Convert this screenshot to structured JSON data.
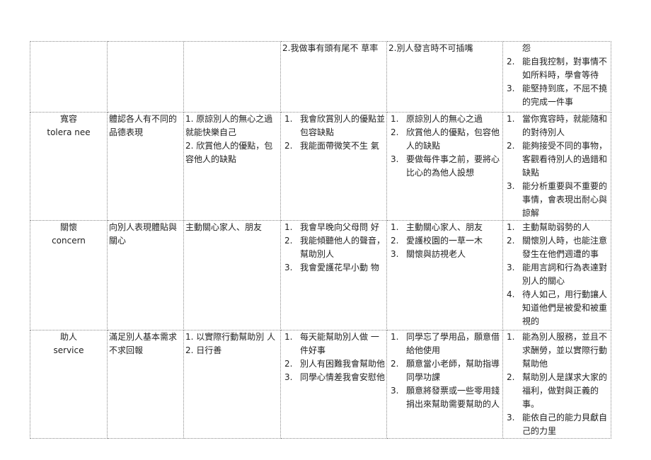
{
  "top_row": {
    "col4": "2.我做事有頭有尾不 草率",
    "col5": "2.別人發言時不可插嘴",
    "col6_continuation": "怨",
    "col6_items": [
      {
        "num": "2.",
        "text": "能自我控制，對事情不如所料時，學會等待"
      },
      {
        "num": "3.",
        "text": "能堅持到底，不屈不撓的完成一件事"
      }
    ]
  },
  "rows": [
    {
      "virtue_zh": "寬容",
      "virtue_en": "tolera nee",
      "definition": "體認各人有不同的品德表現",
      "goals": [
        "1. 原諒別人的無心之過就能快樂自己",
        "2. 欣賞他人的優點，包容他人的缺點"
      ],
      "col4_items": [
        {
          "num": "1.",
          "text": "我會欣賞別人的優點並包容缺點"
        },
        {
          "num": "2.",
          "text": "我能面帶微笑不生 氣"
        }
      ],
      "col5_items": [
        {
          "num": "1.",
          "text": "原諒別人的無心之過"
        },
        {
          "num": "2.",
          "text": "欣賞他人的優點，包容他人的缺點"
        },
        {
          "num": "3.",
          "text": "要做每件事之前，要將心比心的為他人設想"
        }
      ],
      "col6_items": [
        {
          "num": "1.",
          "text": "當你寬容時，就能隨和的對待別人"
        },
        {
          "num": "2.",
          "text": "能夠接受不同的事物，客觀看待別人的過錯和缺點"
        },
        {
          "num": "3.",
          "text": "能分析重要與不重要的事情，會表現出耐心與諒解"
        }
      ]
    },
    {
      "virtue_zh": "關懷",
      "virtue_en": "concern",
      "definition": "向別人表現體貼與關心",
      "goals": [
        "主動關心家人、朋友"
      ],
      "col4_items": [
        {
          "num": "1.",
          "text": "我會早晚向父母問 好"
        },
        {
          "num": "2.",
          "text": "我能傾聽他人的聲音，幫助別人"
        },
        {
          "num": "3.",
          "text": "我會愛護花早小動 物"
        }
      ],
      "col5_items": [
        {
          "num": "1.",
          "text": "主動關心家人、朋友"
        },
        {
          "num": "2.",
          "text": "愛護校園的一草一木"
        },
        {
          "num": "3.",
          "text": "關懷與訪視老人"
        }
      ],
      "col6_items": [
        {
          "num": "1.",
          "text": "主動幫助弱勢的人"
        },
        {
          "num": "2.",
          "text": "關懷別人時，也能注意發生在他們週遭的事"
        },
        {
          "num": "3.",
          "text": "能用言詞和行為表達對別人的關心"
        },
        {
          "num": "4.",
          "text": "待人如己，用行動讓人知道他們是被愛和被重視的"
        }
      ]
    },
    {
      "virtue_zh": "助人",
      "virtue_en": "service",
      "definition": "滿足別人基本需求不求回報",
      "goals": [
        "1. 以實際行動幫助別 人",
        "2. 日行善"
      ],
      "col4_items": [
        {
          "num": "1.",
          "text": "每天能幫助別人做 一件好事"
        },
        {
          "num": "2.",
          "text": "別人有困難我會幫助他"
        },
        {
          "num": "3.",
          "text": "同學心情差我會安慰他"
        }
      ],
      "col5_items": [
        {
          "num": "1.",
          "text": "同學忘了學用品，願意借給他使用"
        },
        {
          "num": "2.",
          "text": "願意當小老師，幫助指導同學功課"
        },
        {
          "num": "3.",
          "text": "願意將發票或一些零用錢捐出來幫助需要幫助的人"
        }
      ],
      "col6_items": [
        {
          "num": "1.",
          "text": "能為別人服務，並且不求酬勞，並以實際行動幫助他"
        },
        {
          "num": "2.",
          "text": "幫助別人是謀求大家的福利，做對與正義的事。"
        },
        {
          "num": "3.",
          "text": "能依自己的能力貝獻自己的力里"
        }
      ]
    }
  ]
}
